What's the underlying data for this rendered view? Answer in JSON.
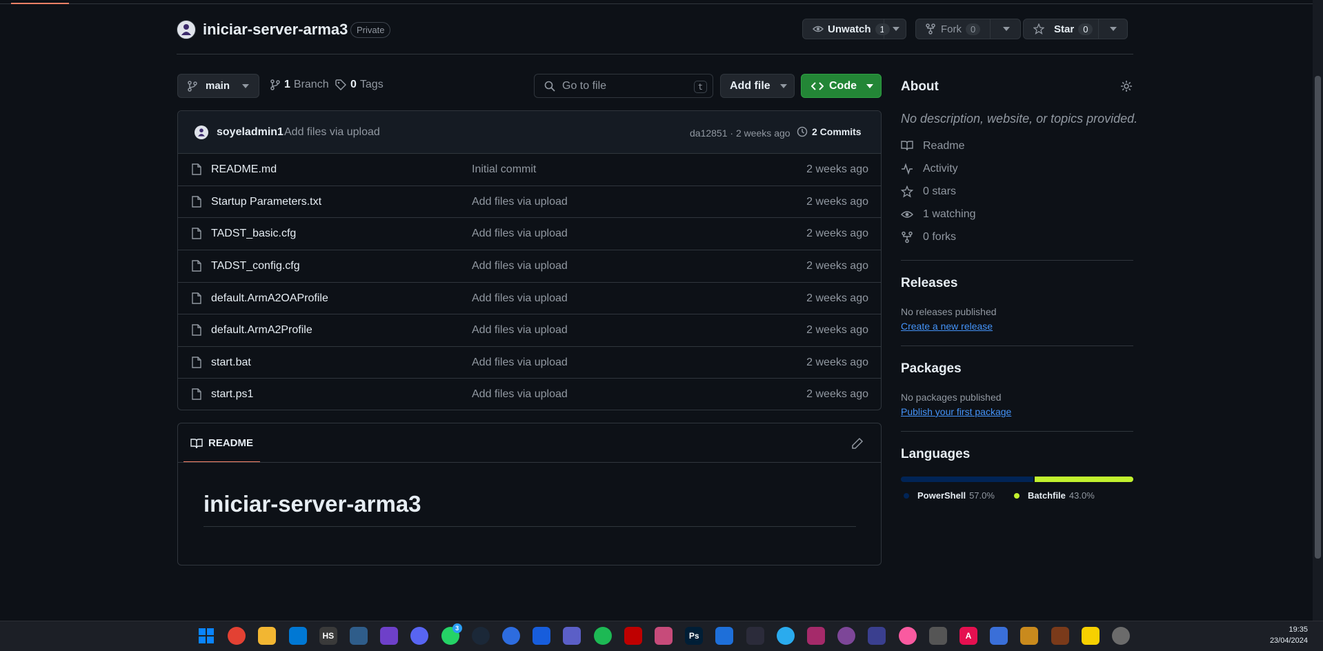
{
  "repo": {
    "name": "iniciar-server-arma3",
    "visibility": "Private"
  },
  "actions": {
    "unwatch_label": "Unwatch",
    "unwatch_count": "1",
    "fork_label": "Fork",
    "fork_count": "0",
    "star_label": "Star",
    "star_count": "0"
  },
  "toolbar": {
    "branch": "main",
    "branch_count": "1",
    "branch_label": "Branch",
    "tag_count": "0",
    "tag_label": "Tags",
    "search_placeholder": "Go to file",
    "search_shortcut": "t",
    "add_file_label": "Add file",
    "code_label": "Code"
  },
  "commit": {
    "author": "soyeladmin1",
    "message": "Add files via upload",
    "hash_time": "da12851 · 2 weeks ago",
    "commits_label": "2 Commits"
  },
  "files": [
    {
      "name": "README.md",
      "message": "Initial commit",
      "date": "2 weeks ago"
    },
    {
      "name": "Startup Parameters.txt",
      "message": "Add files via upload",
      "date": "2 weeks ago"
    },
    {
      "name": "TADST_basic.cfg",
      "message": "Add files via upload",
      "date": "2 weeks ago"
    },
    {
      "name": "TADST_config.cfg",
      "message": "Add files via upload",
      "date": "2 weeks ago"
    },
    {
      "name": "default.ArmA2OAProfile",
      "message": "Add files via upload",
      "date": "2 weeks ago"
    },
    {
      "name": "default.ArmA2Profile",
      "message": "Add files via upload",
      "date": "2 weeks ago"
    },
    {
      "name": "start.bat",
      "message": "Add files via upload",
      "date": "2 weeks ago"
    },
    {
      "name": "start.ps1",
      "message": "Add files via upload",
      "date": "2 weeks ago"
    }
  ],
  "readme": {
    "tab_label": "README",
    "heading": "iniciar-server-arma3"
  },
  "about": {
    "title": "About",
    "description": "No description, website, or topics provided.",
    "items": [
      {
        "icon": "book-icon",
        "label": "Readme"
      },
      {
        "icon": "pulse-icon",
        "label": "Activity"
      },
      {
        "icon": "star-icon",
        "label": "0 stars"
      },
      {
        "icon": "eye-icon",
        "label": "1 watching"
      },
      {
        "icon": "fork-icon",
        "label": "0 forks"
      }
    ]
  },
  "releases": {
    "title": "Releases",
    "status": "No releases published",
    "link": "Create a new release"
  },
  "packages": {
    "title": "Packages",
    "status": "No packages published",
    "link": "Publish your first package"
  },
  "languages": {
    "title": "Languages",
    "items": [
      {
        "name": "PowerShell",
        "percent": "57.0%",
        "value": 57.0,
        "color": "#012456"
      },
      {
        "name": "Batchfile",
        "percent": "43.0%",
        "value": 43.0,
        "color": "#c1f12e"
      }
    ]
  },
  "taskbar": {
    "time": "19:35",
    "date": "23/04/2024",
    "whatsapp_badge": "3",
    "apps": [
      "windows-start-icon",
      "chrome-icon",
      "file-explorer-icon",
      "vscode-icon",
      "hs-icon",
      "app-icon-blue",
      "github-desktop-icon",
      "discord-icon",
      "whatsapp-icon",
      "steam-icon",
      "app-icon-circle",
      "bitwarden-icon",
      "teams-icon",
      "spotify-icon",
      "filezilla-icon",
      "snipping-tool-icon",
      "photoshop-icon",
      "app-icon-swirl",
      "vpn-icon",
      "telegram-icon",
      "winrar-icon",
      "tor-icon",
      "app-icon-bar",
      "itunes-icon",
      "app-icon-mac",
      "autocad-icon",
      "app-icon-pc",
      "app-icon-chart",
      "game-icon",
      "sticky-notes-icon",
      "settings-icon"
    ],
    "labels": {
      "hs": "HS",
      "ps": "Ps",
      "autocad": "A"
    },
    "colors": {
      "accent": "#238636",
      "link": "#4493f8",
      "border": "#30363d",
      "underline": "#f78166"
    }
  }
}
